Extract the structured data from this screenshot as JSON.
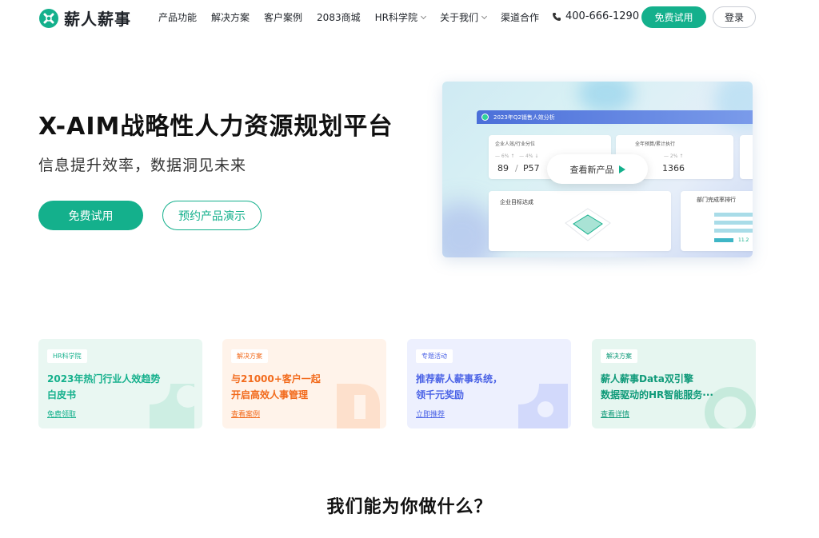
{
  "brand": {
    "name": "薪人薪事",
    "color": "#14b08c"
  },
  "nav": [
    {
      "label": "产品功能",
      "dropdown": false
    },
    {
      "label": "解决方案",
      "dropdown": false
    },
    {
      "label": "客户案例",
      "dropdown": false
    },
    {
      "label": "2083商城",
      "dropdown": false
    },
    {
      "label": "HR科学院",
      "dropdown": true
    },
    {
      "label": "关于我们",
      "dropdown": true
    },
    {
      "label": "渠道合作",
      "dropdown": false
    }
  ],
  "header": {
    "phone": "400-666-1290",
    "trial_label": "免费试用",
    "login_label": "登录"
  },
  "hero": {
    "title": "X-AIM战略性人力资源规划平台",
    "subtitle": "信息提升效率，数据洞见未来",
    "trial_label": "免费试用",
    "demo_label": "预约产品演示"
  },
  "preview": {
    "dashboard_title": "2023年Q2销售人效分析",
    "kpi1_label": "企业人效/行业分位",
    "kpi1_value_a": "89",
    "kpi1_value_b": "P57",
    "kpi2_label": "全年预算/累计执行",
    "kpi2_value": "1366",
    "goal_label": "企业目标达成",
    "rank_label": "部门完成率排行",
    "rank_value": "11.2",
    "play_label": "查看新产品"
  },
  "promos": [
    {
      "tag": "HR科学院",
      "line1": "2023年热门行业人效趋势",
      "line2": "白皮书",
      "link": "免费领取",
      "accent": "#14b08c",
      "bg": "#e9f7f2"
    },
    {
      "tag": "解决方案",
      "line1": "与21000+客户一起",
      "line2": "开启高效人事管理",
      "link": "查看案例",
      "accent": "#f26b1d",
      "bg": "#fff3ea"
    },
    {
      "tag": "专题活动",
      "line1": "推荐薪人薪事系统，",
      "line2": "领千元奖励",
      "link": "立即推荐",
      "accent": "#4b63e6",
      "bg": "#edf0fe"
    },
    {
      "tag": "解决方案",
      "line1": "薪人薪事Data双引擎",
      "line2": "数据驱动的HR智能服务···",
      "link": "查看详情",
      "accent": "#0f9a79",
      "bg": "#e6f6f0"
    }
  ],
  "section": {
    "title": "我们能为你做什么？"
  }
}
